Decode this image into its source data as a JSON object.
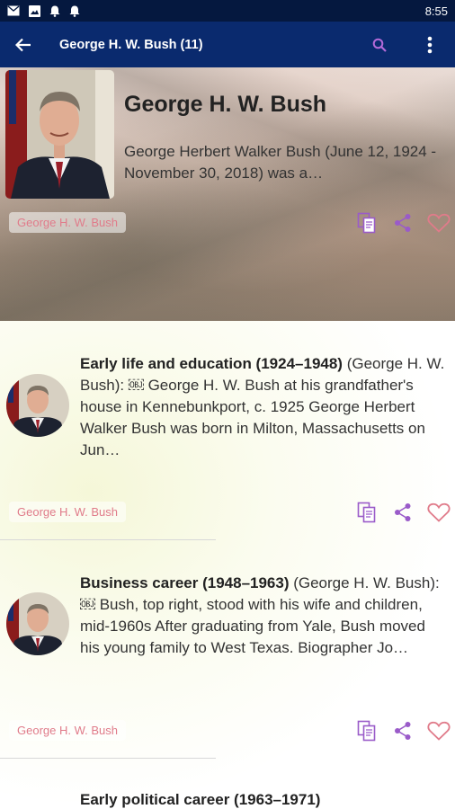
{
  "status_bar": {
    "time": "8:55"
  },
  "app_bar": {
    "title": "George H. W. Bush (11)"
  },
  "hero": {
    "name": "George H. W. Bush",
    "description": "George Herbert Walker Bush (June 12, 1924 - November 30, 2018) was a…",
    "tag": "George H. W. Bush"
  },
  "articles": [
    {
      "title": "Early life and education (1924–1948)",
      "body": " (George H. W. Bush): ￼ George H. W. Bush at his grandfather's house in Kennebunkport, c. 1925 George Herbert Walker Bush was born in Milton, Massachusetts on Jun…",
      "tag": "George H. W. Bush"
    },
    {
      "title": "Business career (1948–1963)",
      "body": " (George H. W. Bush): ￼ Bush, top right, stood with his wife and children, mid-1960s After graduating from Yale, Bush moved his young family to West Texas. Biographer Jo…",
      "tag": "George H. W. Bush"
    },
    {
      "title": "Early political career (1963–1971)",
      "body": "",
      "tag": ""
    }
  ],
  "colors": {
    "status_bar": "#05183f",
    "app_bar": "#0a2a6e",
    "accent": "#8e44c8",
    "heart": "#e07b8a"
  }
}
